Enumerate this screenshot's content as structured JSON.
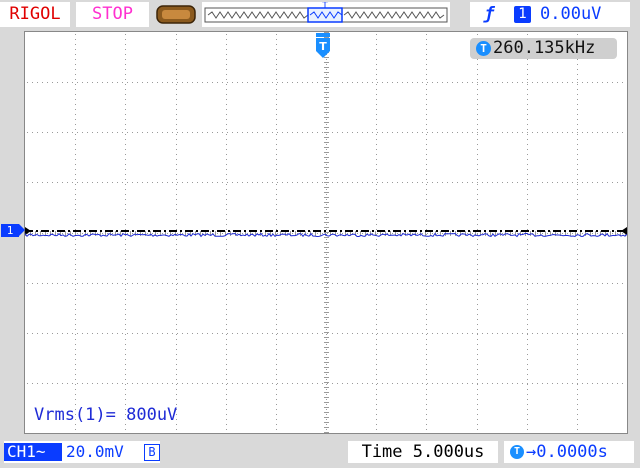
{
  "header": {
    "brand": "RIGOL",
    "run_state": "STOP",
    "memory_icon": "memory-depth-icon",
    "trigger": {
      "edge_symbol": "ƒ",
      "channel": "1",
      "level": "0.00uV"
    }
  },
  "screen": {
    "frequency_counter": {
      "icon_letter": "T",
      "value": "260.135kHz"
    },
    "channel_marker": "1",
    "trigger_marker": "T",
    "measurement": "Vrms(1)= 800uV",
    "trace": {
      "channel": "CH1",
      "level_fraction": 0.5
    }
  },
  "footer": {
    "channel_label": "CH1",
    "coupling_symbol": "~",
    "scale": "20.0mV",
    "bw_limit": "B",
    "timebase": "Time 5.000us",
    "delay_icon": "T",
    "delay": "→0.0000s"
  },
  "colors": {
    "brand": "#e00000",
    "run_state": "#ff2fd0",
    "channel1": "#1f2bd6",
    "trigger": "#0a3cff",
    "background": "#d9d9d9"
  }
}
